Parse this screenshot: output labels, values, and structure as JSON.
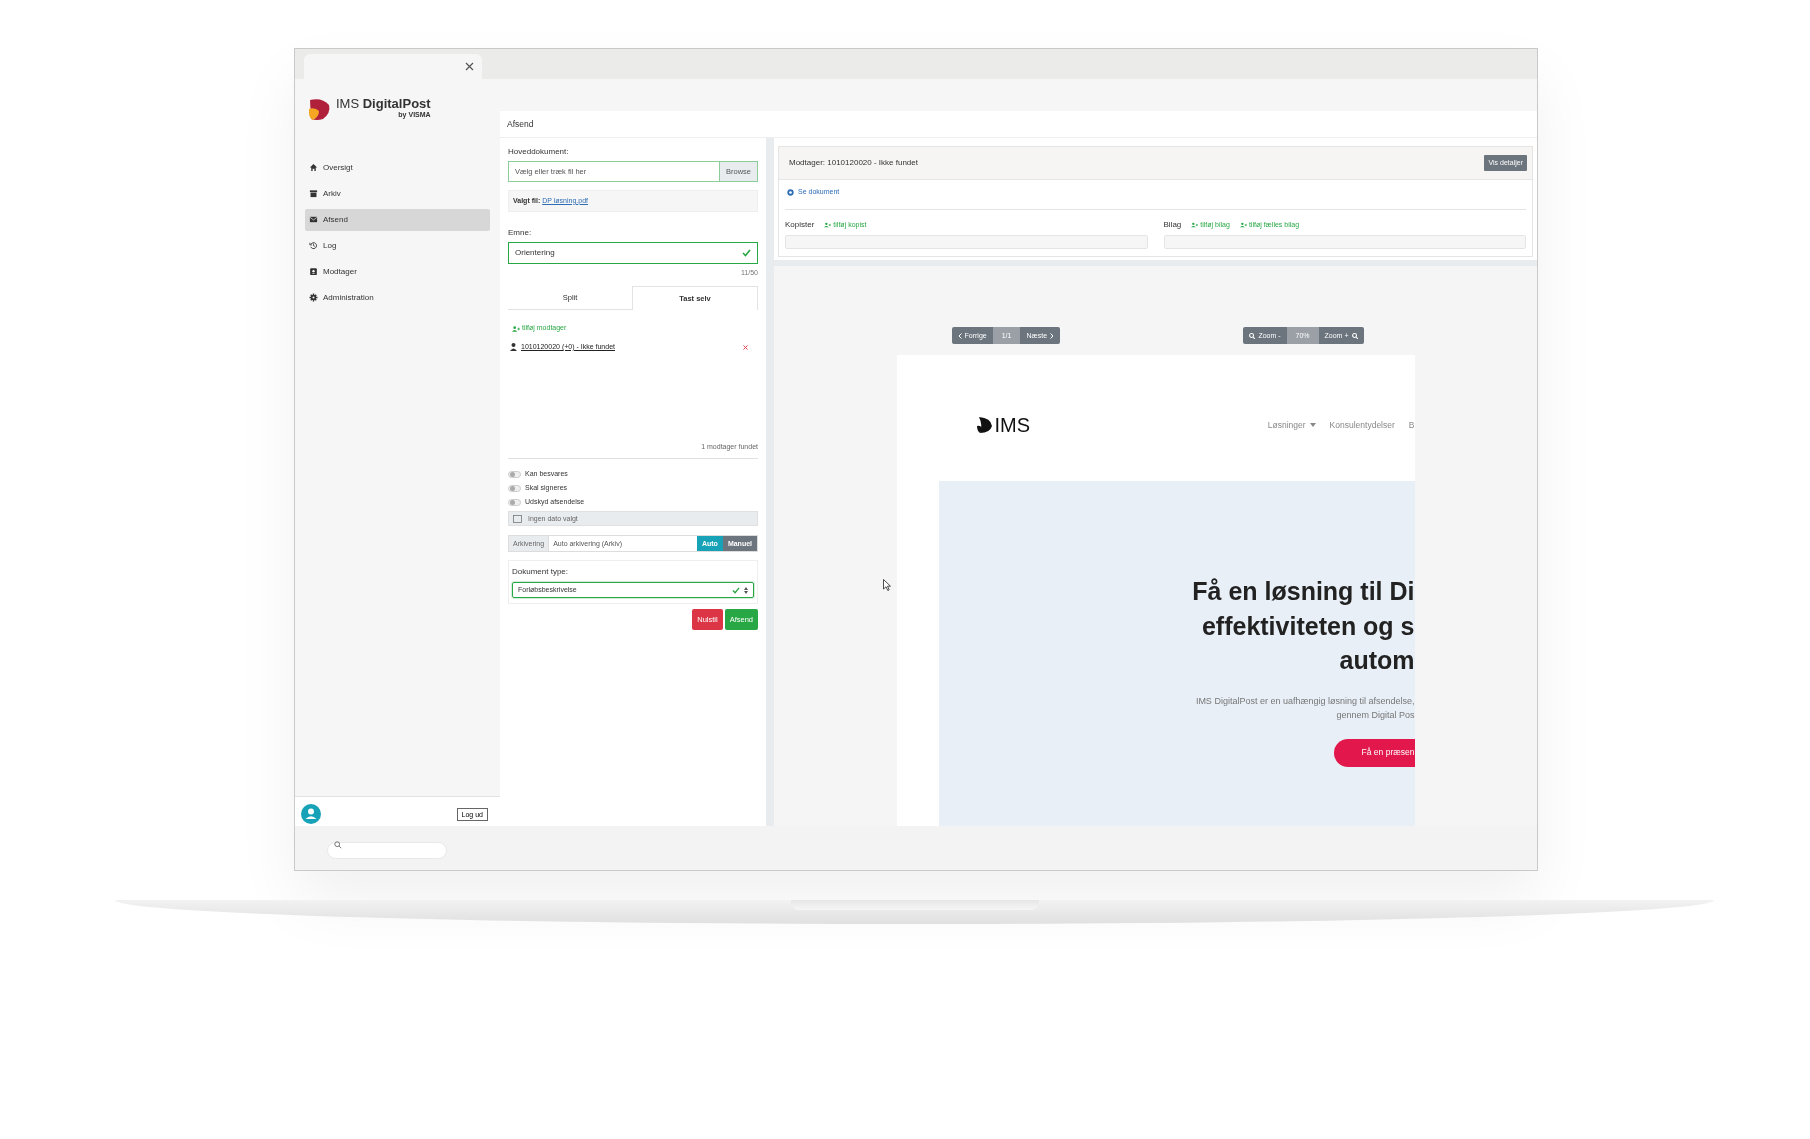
{
  "sidebar": {
    "logo": {
      "brand": "IMS **DigitalPost**",
      "byline": "by VISMA"
    },
    "items": [
      {
        "label": "Oversigt",
        "kind": "home",
        "selected": false
      },
      {
        "label": "Arkiv",
        "kind": "archive",
        "selected": false
      },
      {
        "label": "Afsend",
        "kind": "envelope",
        "selected": true
      },
      {
        "label": "Log",
        "kind": "history",
        "selected": false
      },
      {
        "label": "Modtager",
        "kind": "contact",
        "selected": false
      },
      {
        "label": "Administration",
        "kind": "gear",
        "selected": false
      }
    ],
    "logout": "Log ud"
  },
  "page_title": "Afsend",
  "form": {
    "main_doc_label": "Hoveddokument:",
    "file_placeholder": "Vælg eller træk fil her",
    "browse": "Browse",
    "chosen_label": "Valgt fil:",
    "chosen_file": "DP løsning.pdf",
    "subject_label": "Emne:",
    "subject_value": "Orientering",
    "subject_valid": true,
    "subject_count": "11/50",
    "tabs": [
      {
        "label": "Split",
        "selected": false
      },
      {
        "label": "Tast selv",
        "selected": true
      }
    ],
    "add_recipient": "tilføj modtager",
    "recipients": [
      {
        "label": "1010120020 (+0) - Ikke fundet"
      }
    ],
    "recipient_count": "1 modtager fundet",
    "toggles": [
      {
        "label": "Kan besvares",
        "on": false
      },
      {
        "label": "Skal signeres",
        "on": false
      },
      {
        "label": "Udskyd afsendelse",
        "on": false
      }
    ],
    "date_placeholder": "Ingen dato valgt",
    "archive": {
      "label": "Arkivering",
      "value": "Auto arkivering (Arkiv)",
      "modes": [
        {
          "label": "Auto",
          "selected": true
        },
        {
          "label": "Manuel",
          "selected": false
        }
      ]
    },
    "doc_type": {
      "label": "Dokument type:",
      "value": "Forløbsbeskrivelse",
      "valid": true
    },
    "reset": "Nulstil",
    "send": "Afsend"
  },
  "preview": {
    "recipient_title": "Modtager: 1010120020 - Ikke fundet",
    "details_button": "Vis detaljer",
    "view_document": "Se dokument",
    "copies_label": "Kopister",
    "add_copy": "tilføj kopist",
    "attachments_label": "Bilag",
    "add_attachment": "tilføj bilag",
    "add_shared_attachment": "tilføj fælles bilag",
    "pager": {
      "prev": "Forrige",
      "page": "1/1",
      "next": "Næste"
    },
    "zoom": {
      "out": "Zoom -",
      "level": "70%",
      "in": "Zoom +"
    },
    "document": {
      "logo": "IMS",
      "nav": [
        "Løsninger",
        "Konsulentydelser",
        "B"
      ],
      "headline_lines": [
        "Få en løsning til Di",
        "effektiviteten og s",
        "autom"
      ],
      "lead_lines": [
        "IMS DigitalPost er en uafhængig løsning til afsendelse,",
        "gennem Digital Pos"
      ],
      "cta": "Få en præsen"
    }
  }
}
